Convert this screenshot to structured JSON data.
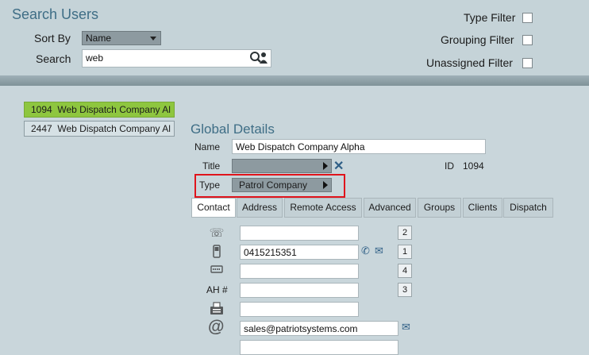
{
  "search": {
    "title": "Search Users",
    "sort_label": "Sort By",
    "sort_value": "Name",
    "search_label": "Search",
    "search_value": "web",
    "filters": [
      {
        "label": "Type Filter",
        "checked": false
      },
      {
        "label": "Grouping Filter",
        "checked": false
      },
      {
        "label": "Unassigned Filter",
        "checked": false
      }
    ]
  },
  "results": [
    {
      "id": "1094",
      "name": "Web Dispatch Company Al",
      "selected": true
    },
    {
      "id": "2447",
      "name": "Web Dispatch Company Al",
      "selected": false
    }
  ],
  "details": {
    "title": "Global Details",
    "name_label": "Name",
    "name_value": "Web Dispatch Company Alpha",
    "title_label": "Title",
    "title_value": "",
    "id_label": "ID",
    "id_value": "1094",
    "type_label": "Type",
    "type_value": "Patrol Company"
  },
  "tabs": [
    "Contact",
    "Address",
    "Remote Access",
    "Advanced",
    "Groups",
    "Clients",
    "Dispatch"
  ],
  "active_tab": "Contact",
  "contact": {
    "rows": [
      {
        "icon": "phone-handset-icon",
        "value": "",
        "num": "2"
      },
      {
        "icon": "mobile-phone-icon",
        "value": "0415215351",
        "num": "1"
      },
      {
        "icon": "pager-icon",
        "value": "",
        "num": "4"
      },
      {
        "label": "AH #",
        "value": "",
        "num": "3"
      },
      {
        "icon": "fax-icon",
        "value": ""
      },
      {
        "icon": "email-at-icon",
        "value": "sales@patriotsystems.com"
      }
    ]
  }
}
